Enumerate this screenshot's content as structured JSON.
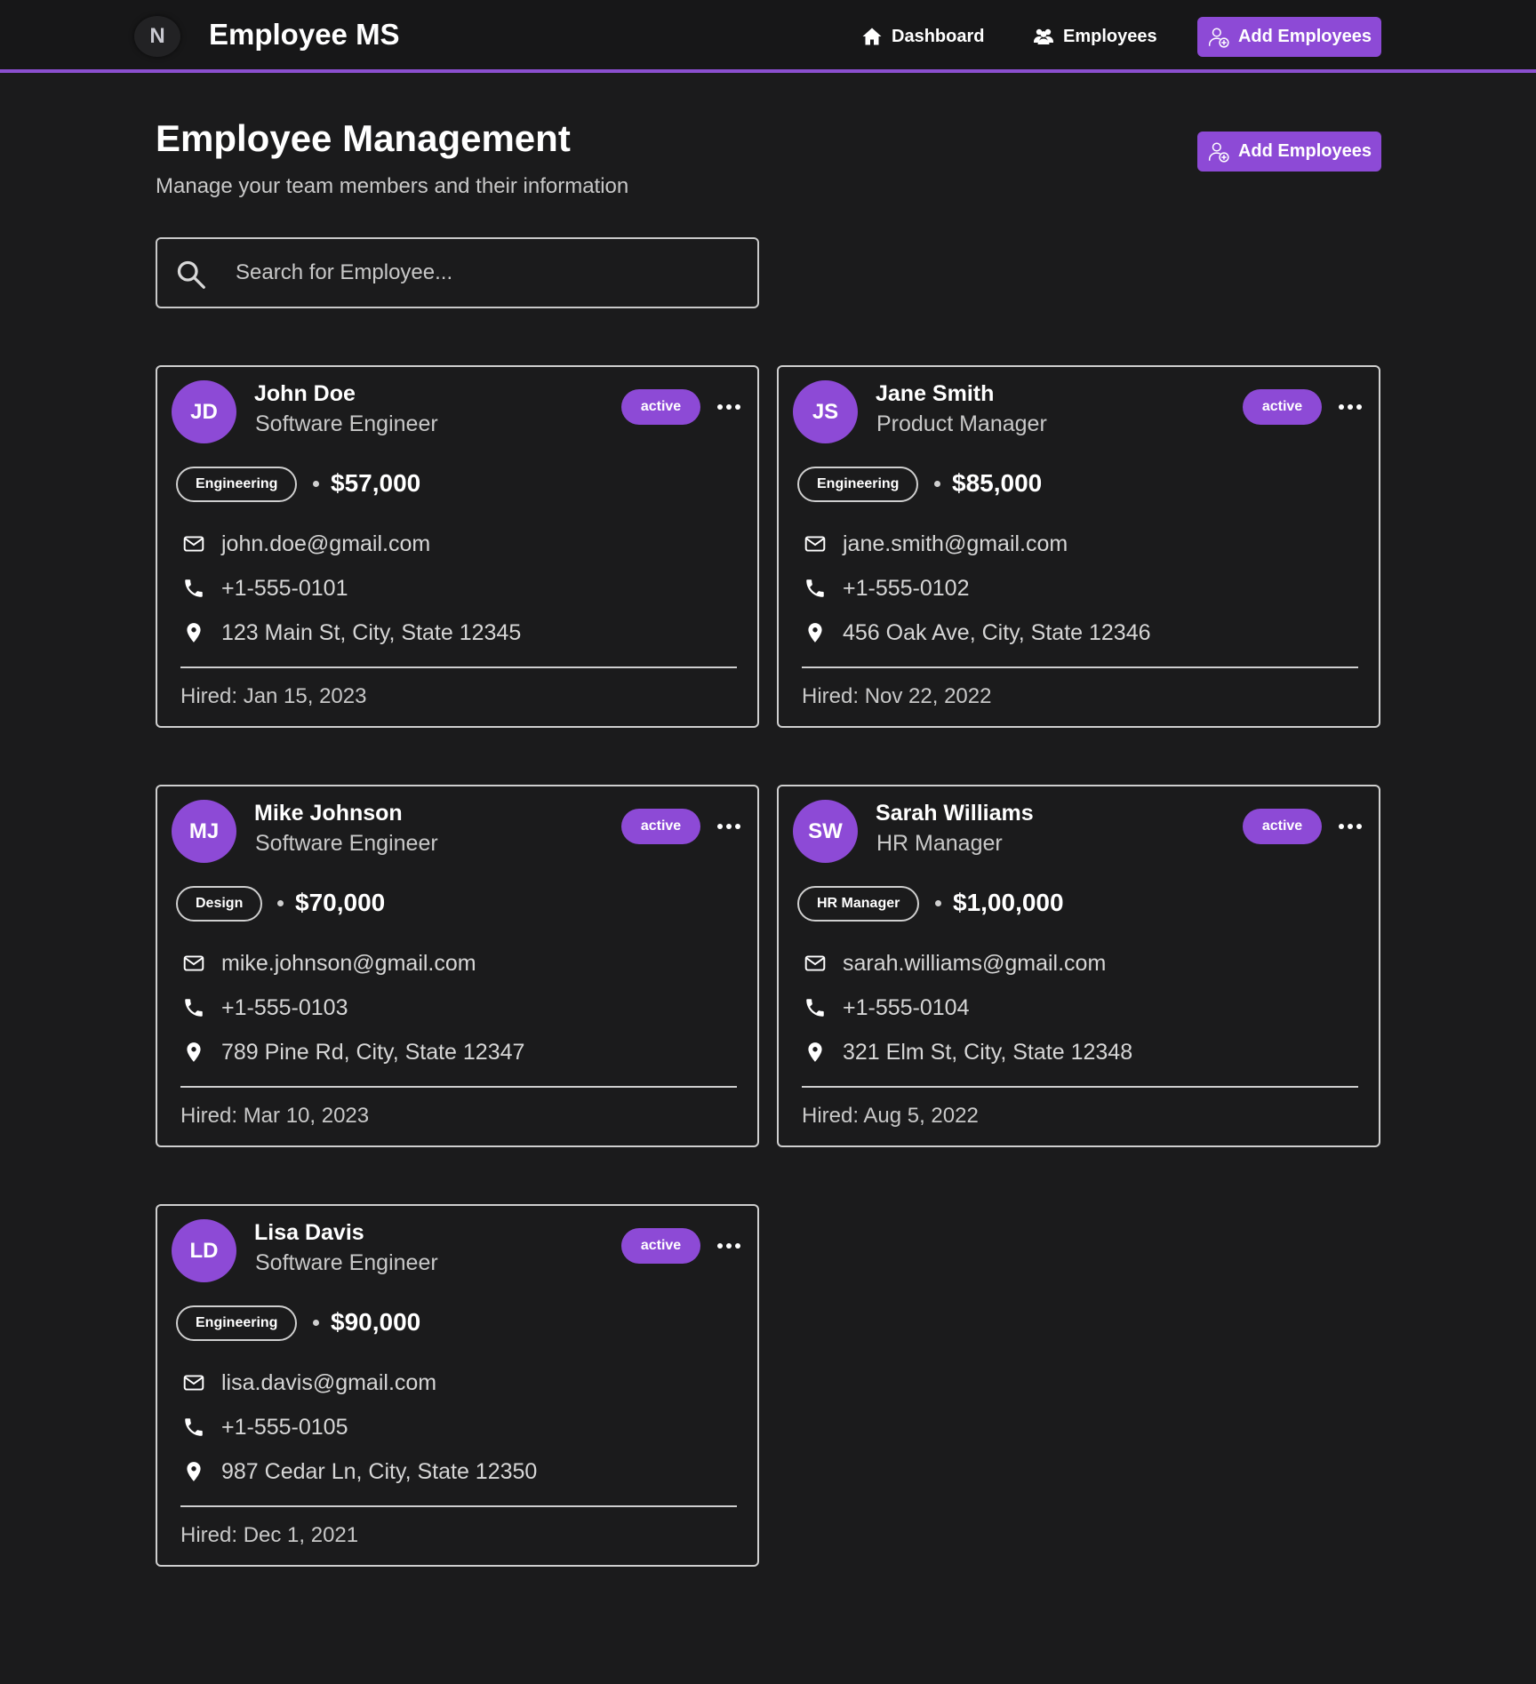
{
  "app": {
    "logo_letter": "N",
    "name": "Employee MS",
    "accent_color": "#8d4ad6"
  },
  "nav": {
    "dashboard_label": "Dashboard",
    "employees_label": "Employees",
    "add_label": "Add Employees"
  },
  "header": {
    "title": "Employee Management",
    "subtitle": "Manage your team members and their information",
    "add_label": "Add Employees"
  },
  "search": {
    "placeholder": "Search for Employee...",
    "value": ""
  },
  "employees": [
    {
      "initials": "JD",
      "name": "John Doe",
      "role": "Software Engineer",
      "status": "active",
      "department": "Engineering",
      "salary": "$57,000",
      "email": "john.doe@gmail.com",
      "phone": "+1-555-0101",
      "address": "123 Main St, City, State 12345",
      "hired": "Hired: Jan 15, 2023"
    },
    {
      "initials": "JS",
      "name": "Jane Smith",
      "role": "Product Manager",
      "status": "active",
      "department": "Engineering",
      "salary": "$85,000",
      "email": "jane.smith@gmail.com",
      "phone": "+1-555-0102",
      "address": "456 Oak Ave, City, State 12346",
      "hired": "Hired: Nov 22, 2022"
    },
    {
      "initials": "MJ",
      "name": "Mike Johnson",
      "role": "Software Engineer",
      "status": "active",
      "department": "Design",
      "salary": "$70,000",
      "email": "mike.johnson@gmail.com",
      "phone": "+1-555-0103",
      "address": "789 Pine Rd, City, State 12347",
      "hired": "Hired: Mar 10, 2023"
    },
    {
      "initials": "SW",
      "name": "Sarah Williams",
      "role": "HR Manager",
      "status": "active",
      "department": "HR Manager",
      "salary": "$1,00,000",
      "email": "sarah.williams@gmail.com",
      "phone": "+1-555-0104",
      "address": "321 Elm St, City, State 12348",
      "hired": "Hired: Aug 5, 2022"
    },
    {
      "initials": "LD",
      "name": "Lisa Davis",
      "role": "Software Engineer",
      "status": "active",
      "department": "Engineering",
      "salary": "$90,000",
      "email": "lisa.davis@gmail.com",
      "phone": "+1-555-0105",
      "address": "987 Cedar Ln, City, State 12350",
      "hired": "Hired: Dec 1, 2021"
    }
  ]
}
